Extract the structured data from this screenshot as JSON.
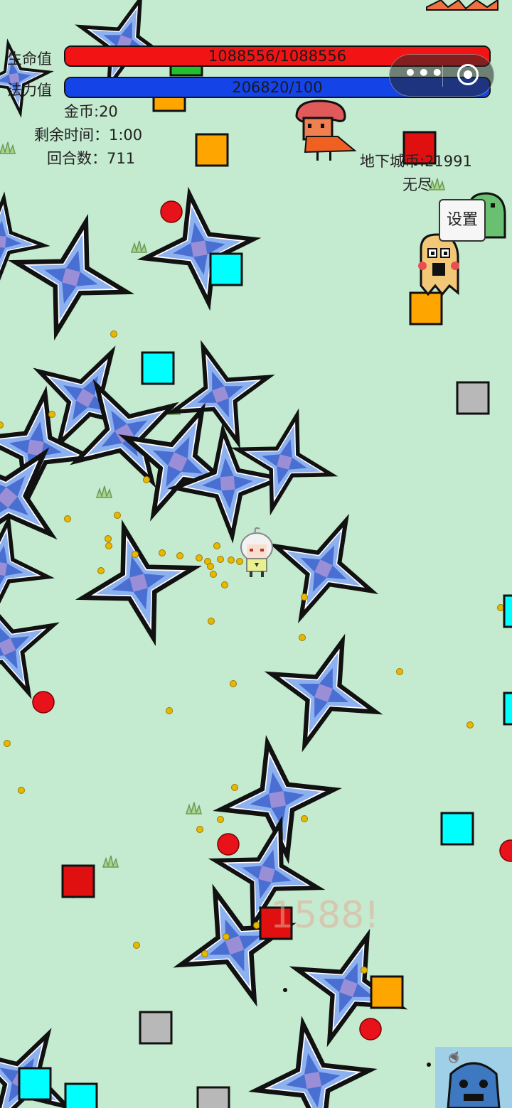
{
  "hud": {
    "hp_label": "生命值",
    "hp_value": "1088556/1088556",
    "hp_fraction": 1.0,
    "hp_color": "#f21414",
    "mp_label": "法力值",
    "mp_value": "206820/100",
    "mp_fraction": 1.0,
    "mp_color": "#1444e8",
    "gold": "金币:20",
    "time_left": "剩余时间：1:00",
    "round": "回合数：711",
    "dungeon_coins": "地下城币:21991",
    "mode": "无尽",
    "settings_label": "设置"
  },
  "miniprogram_capsule": {
    "more_icon": "more-dots-icon",
    "close_icon": "target-circle-icon",
    "more_label": "•••"
  },
  "floating_damage": "1588!",
  "colors": {
    "background": "#c4ead0",
    "shuriken_light": "#7aa5ec",
    "shuriken_dark": "#3b5fc8",
    "red_ball": "#e8121a",
    "gold_coin": "#e6b800",
    "cyan_box": "#00ffff",
    "orange_box": "#ffa500",
    "red_box": "#e01010",
    "gray_box": "#b8b8b8"
  },
  "icons": {
    "player": "player-character-icon",
    "shuriken": "shuriken-projectile-icon",
    "mushroom_enemy": "mushroom-enemy-icon",
    "ghost_enemy": "ghost-enemy-icon",
    "grass": "grass-tuft-icon",
    "turtle": "turtle-sprite-icon"
  }
}
